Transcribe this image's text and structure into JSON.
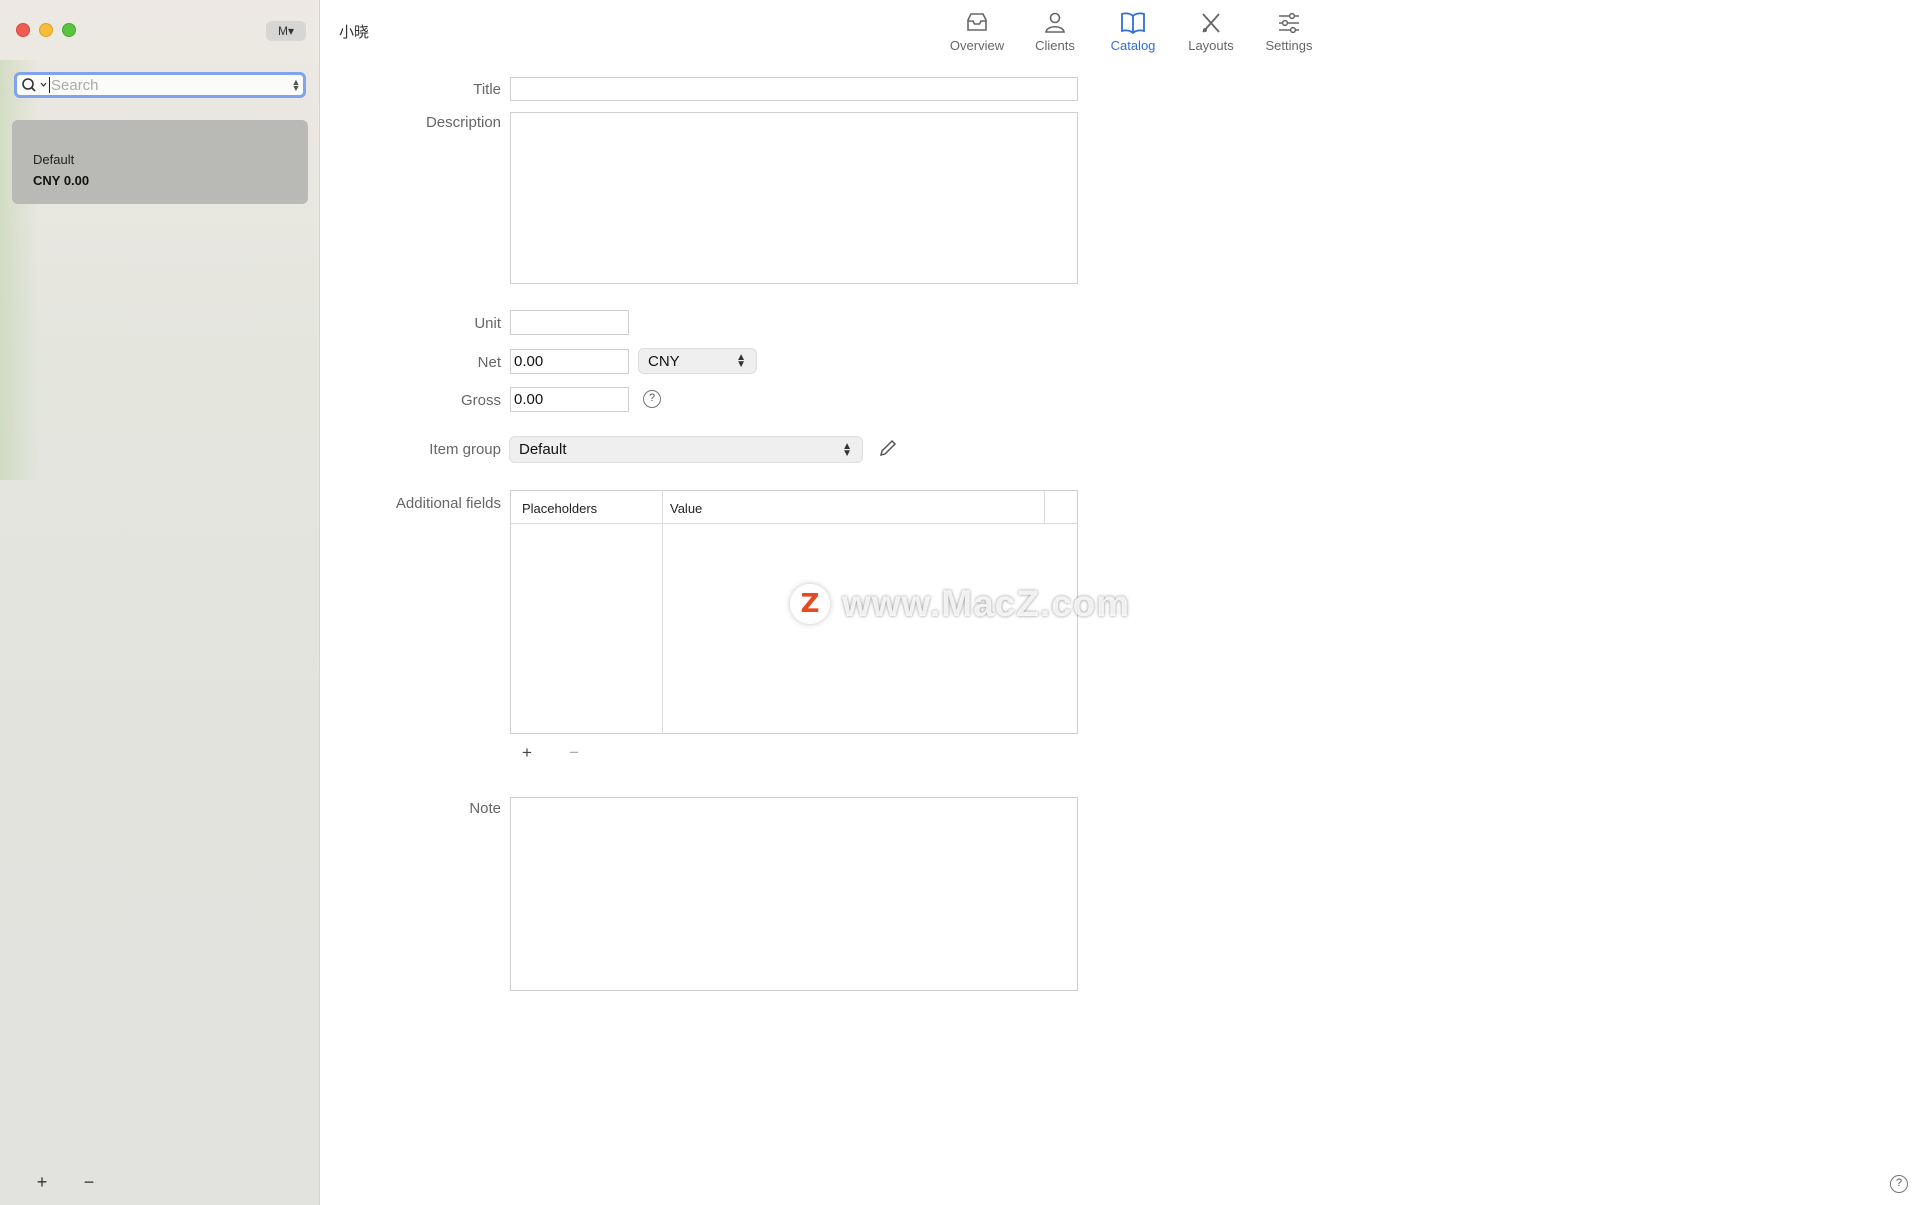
{
  "window": {
    "menu_label": "M▾",
    "title": "小晓"
  },
  "sidebar": {
    "search_placeholder": "Search",
    "items": [
      {
        "name": "Default",
        "price": "CNY 0.00"
      }
    ],
    "add_label": "+",
    "remove_label": "−"
  },
  "toolbar": {
    "items": [
      {
        "label": "Overview",
        "icon": "tray-icon"
      },
      {
        "label": "Clients",
        "icon": "person-icon"
      },
      {
        "label": "Catalog",
        "icon": "book-icon",
        "active": true
      },
      {
        "label": "Layouts",
        "icon": "layout-tools-icon"
      },
      {
        "label": "Settings",
        "icon": "sliders-icon"
      }
    ],
    "accent_color": "#2f6fd6"
  },
  "form": {
    "title_label": "Title",
    "title_value": "",
    "description_label": "Description",
    "description_value": "",
    "unit_label": "Unit",
    "unit_value": "",
    "net_label": "Net",
    "net_value": "0.00",
    "currency": "CNY",
    "gross_label": "Gross",
    "gross_value": "0.00",
    "gross_help": "?",
    "item_group_label": "Item group",
    "item_group_value": "Default",
    "additional_fields_label": "Additional fields",
    "columns": [
      "Placeholders",
      "Value"
    ],
    "add_label": "+",
    "remove_label": "−",
    "note_label": "Note",
    "note_value": ""
  },
  "watermark": {
    "badge": "Z",
    "text": "www.MacZ.com"
  },
  "help_label": "?"
}
